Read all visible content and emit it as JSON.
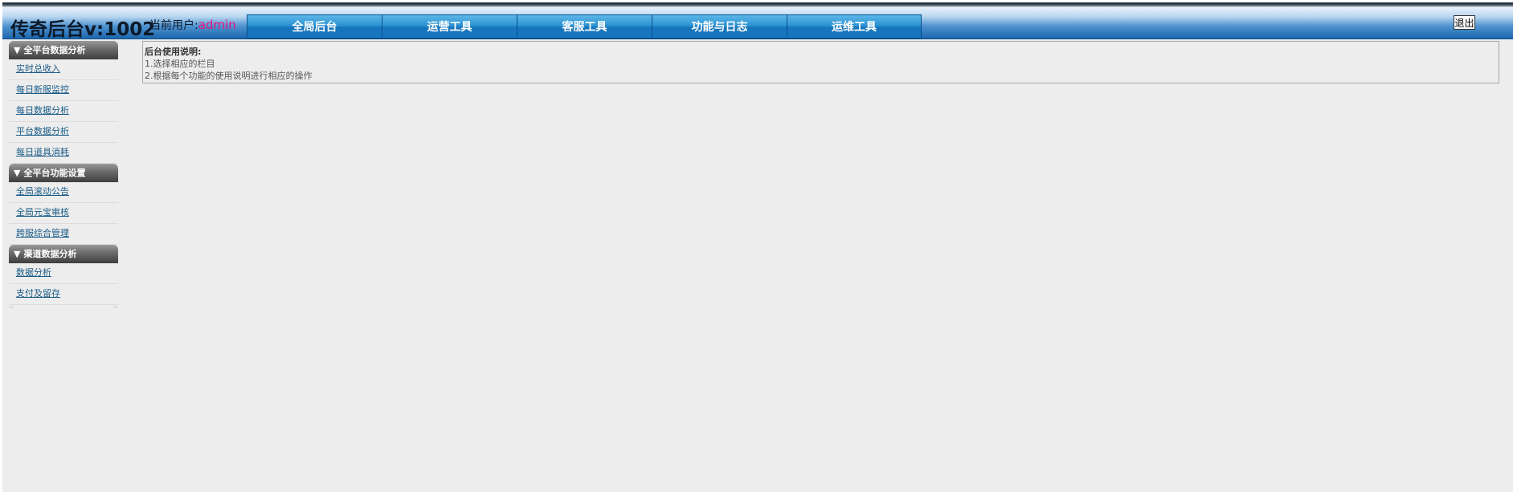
{
  "header": {
    "app_title": "传奇后台v:1002",
    "current_user_label": "当前用户:",
    "username": "admin",
    "logout_label": "退出"
  },
  "nav": {
    "tabs": [
      {
        "label": "全局后台"
      },
      {
        "label": "运营工具"
      },
      {
        "label": "客服工具"
      },
      {
        "label": "功能与日志"
      },
      {
        "label": "运维工具"
      }
    ]
  },
  "sidebar": {
    "sections": [
      {
        "title": "全平台数据分析",
        "links": [
          "实时总收入",
          "每日新服监控",
          "每日数据分析",
          "平台数据分析",
          "每日道具消耗"
        ]
      },
      {
        "title": "全平台功能设置",
        "links": [
          "全局滚动公告",
          "全局元宝审核",
          "跨服综合管理"
        ]
      },
      {
        "title": "渠道数据分析",
        "links": [
          "数据分析",
          "支付及留存"
        ]
      }
    ],
    "toggle_glyph": "▼"
  },
  "main": {
    "help_title": "后台使用说明:",
    "help_lines": [
      "1.选择相应的栏目",
      "2.根据每个功能的使用说明进行相应的操作"
    ]
  },
  "colors": {
    "header_blue": "#1c66ac",
    "nav_tab_blue": "#2d93d3",
    "username_pink": "#e4147d",
    "link_color": "#1a5c88",
    "page_background": "#ededed"
  }
}
